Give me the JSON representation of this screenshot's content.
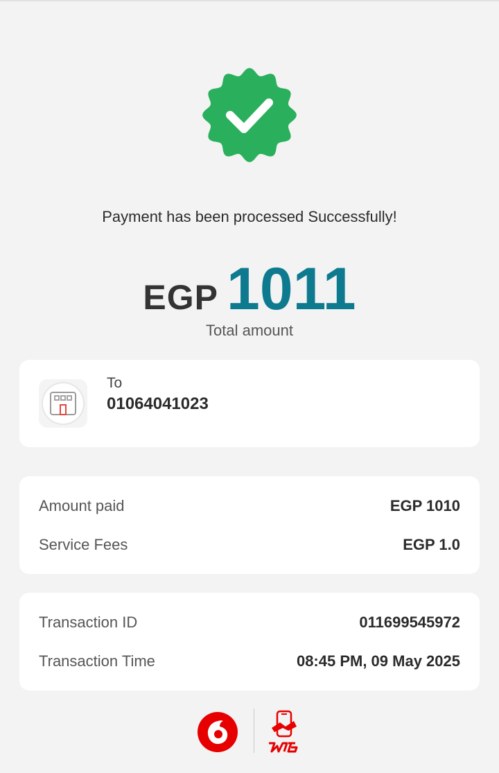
{
  "status": {
    "message": "Payment has been processed Successfully!",
    "icon": "check-badge-icon",
    "color": "#2ab05c"
  },
  "total": {
    "currency": "EGP",
    "value": "1011",
    "label": "Total amount",
    "value_color": "#0e7a8f"
  },
  "recipient": {
    "label": "To",
    "number": "01064041023",
    "icon": "merchant-store-icon"
  },
  "amounts": [
    {
      "label": "Amount paid",
      "value": "EGP 1010"
    },
    {
      "label": "Service Fees",
      "value": "EGP 1.0"
    }
  ],
  "transaction": [
    {
      "label": "Transaction ID",
      "value": "011699545972"
    },
    {
      "label": "Transaction Time",
      "value": "08:45 PM, 09 May 2025"
    }
  ],
  "footer": {
    "logos": [
      "vodafone-logo",
      "vodafone-cash-logo"
    ],
    "brand_color": "#e60000"
  }
}
